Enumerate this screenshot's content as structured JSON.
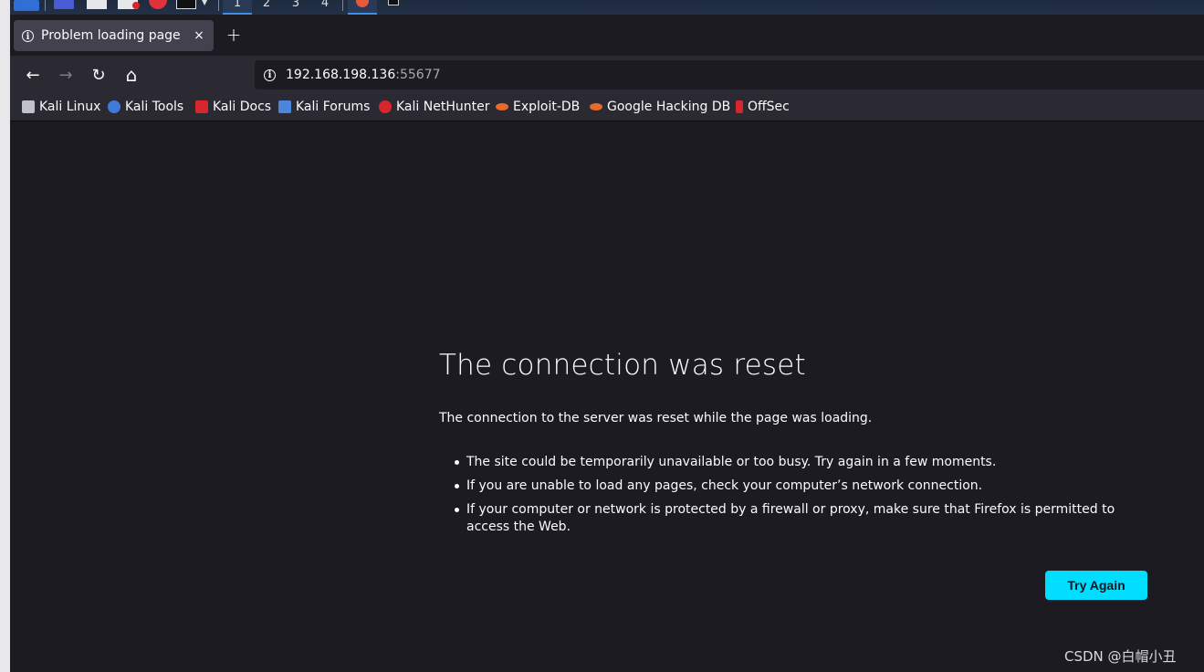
{
  "os_panel": {
    "workspaces": [
      "1",
      "2",
      "3",
      "4"
    ],
    "icons": [
      "kali-menu-icon",
      "desktop-icon",
      "file-manager-icon",
      "text-editor-icon",
      "firefox-icon",
      "terminal-icon"
    ]
  },
  "tab": {
    "title": "Problem loading page",
    "close": "×",
    "new_tab": "+"
  },
  "nav": {
    "back": "←",
    "forward": "→",
    "reload": "↻",
    "home": "⌂"
  },
  "url": {
    "info": "i",
    "host": "192.168.198.136",
    "port": ":55677"
  },
  "bookmarks": [
    {
      "label": "Kali Linux",
      "color": "#bfc3c9"
    },
    {
      "label": "Kali Tools",
      "color": "#3f7bd9"
    },
    {
      "label": "Kali Docs",
      "color": "#d6272f"
    },
    {
      "label": "Kali Forums",
      "color": "#4b86dd"
    },
    {
      "label": "Kali NetHunter",
      "color": "#d6272f"
    },
    {
      "label": "Exploit-DB",
      "color": "#e86a2a"
    },
    {
      "label": "Google Hacking DB",
      "color": "#e86a2a"
    },
    {
      "label": "OffSec",
      "color": "#d6272f"
    }
  ],
  "error": {
    "title": "The connection was reset",
    "description": "The connection to the server was reset while the page was loading.",
    "bullets": [
      "The site could be temporarily unavailable or too busy. Try again in a few moments.",
      "If you are unable to load any pages, check your computer’s network connection.",
      "If your computer or network is protected by a firewall or proxy, make sure that Firefox is permitted to access the Web."
    ],
    "try_again": "Try Again"
  },
  "watermark": "CSDN @白帽小丑",
  "colors": {
    "accent": "#00ddff",
    "page_background": "#1c1b22",
    "toolbar": "#2b2a33"
  }
}
